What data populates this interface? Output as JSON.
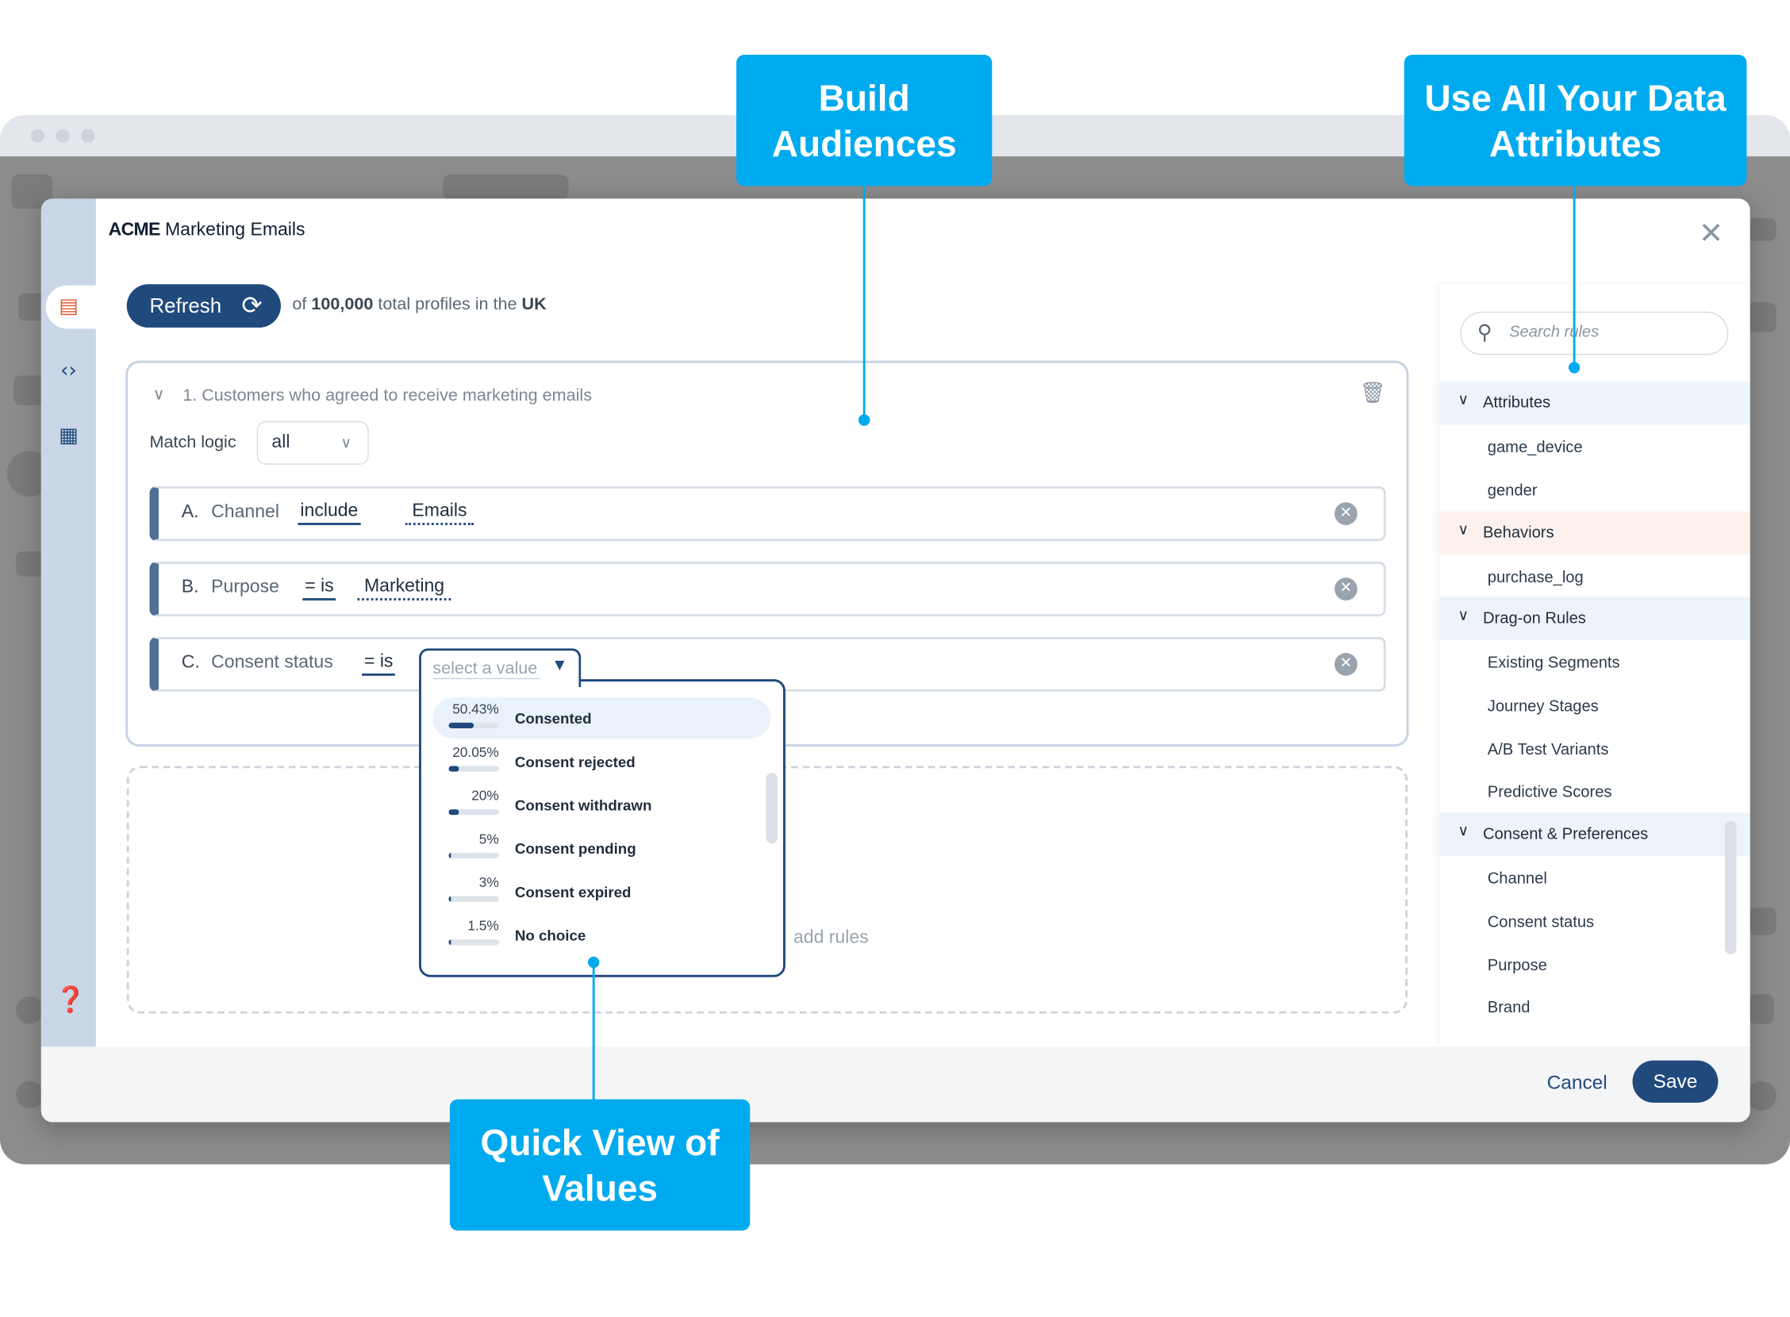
{
  "modal": {
    "title_brand": "ACME",
    "title_rest": "Marketing Emails",
    "close_icon": "close-icon"
  },
  "toolbar": {
    "refresh_label": "Refresh",
    "profiles_prefix": "of ",
    "profiles_count": "100,000",
    "profiles_mid": " total profiles in the ",
    "profiles_region": "UK"
  },
  "rule_group": {
    "title": "1. Customers who agreed to receive marketing emails",
    "match_logic_label": "Match logic",
    "match_logic_value": "all",
    "rules": [
      {
        "letter": "A.",
        "field": "Channel",
        "operator": "include",
        "value": "Emails"
      },
      {
        "letter": "B.",
        "field": "Purpose",
        "operator": "= is",
        "value": "Marketing"
      },
      {
        "letter": "C.",
        "field": "Consent status",
        "operator": "= is",
        "value": ""
      }
    ],
    "value_placeholder": "select a value"
  },
  "dropdown": {
    "options": [
      {
        "pct": "50.43%",
        "fraction": 0.5043,
        "label": "Consented"
      },
      {
        "pct": "20.05%",
        "fraction": 0.2005,
        "label": "Consent rejected"
      },
      {
        "pct": "20%",
        "fraction": 0.2,
        "label": "Consent withdrawn"
      },
      {
        "pct": "5%",
        "fraction": 0.05,
        "label": "Consent pending"
      },
      {
        "pct": "3%",
        "fraction": 0.03,
        "label": "Consent expired"
      },
      {
        "pct": "1.5%",
        "fraction": 0.015,
        "label": "No choice"
      }
    ]
  },
  "dropzone": {
    "text": "add rules"
  },
  "sidebar": {
    "search_placeholder": "Search rules",
    "sections": [
      {
        "label": "Attributes",
        "items": [
          "game_device",
          "gender"
        ]
      },
      {
        "label": "Behaviors",
        "items": [
          "purchase_log"
        ]
      },
      {
        "label": "Drag-on Rules",
        "items": [
          "Existing Segments",
          "Journey Stages",
          "A/B Test Variants",
          "Predictive Scores"
        ]
      },
      {
        "label": "Consent & Preferences",
        "items": [
          "Channel",
          "Consent status",
          "Purpose",
          "Brand"
        ]
      }
    ]
  },
  "footer": {
    "cancel_label": "Cancel",
    "save_label": "Save"
  },
  "callouts": {
    "build": "Build Audiences",
    "attributes": "Use All Your Data Attributes",
    "quickview": "Quick View of Values"
  },
  "colors": {
    "primary": "#20497c",
    "callout": "#00aaef",
    "row_accent": "#4f6f95"
  }
}
